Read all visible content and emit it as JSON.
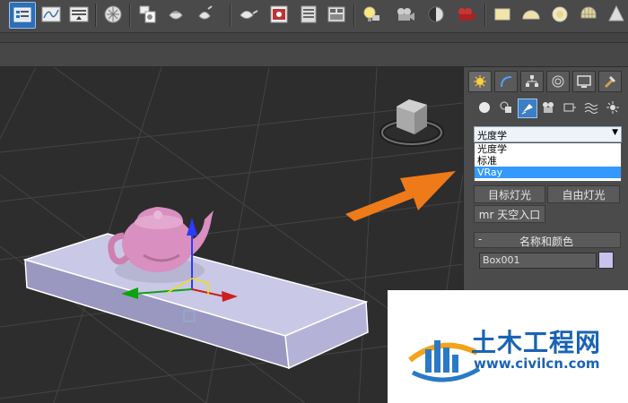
{
  "toolbar": {
    "icons": [
      "select-by-name-icon",
      "curve-editor-icon",
      "dope-sheet-icon",
      "schematic-view-icon",
      "material-editor-icon",
      "render-setup-icon",
      "render-frame-icon",
      "teapot-icon",
      "rendered-frame-window-icon",
      "layer-manager-icon",
      "ribbon-icon",
      "light-bulb-icon",
      "camera-icon",
      "environment-icon",
      "render-icon",
      "box-primitive-icon",
      "sphere-primitive-icon",
      "torus-primitive-icon",
      "geosphere-icon",
      "cone-icon"
    ]
  },
  "command_panel": {
    "tabs": [
      "create-tab",
      "modify-tab",
      "hierarchy-tab",
      "motion-tab",
      "display-tab",
      "utilities-tab"
    ],
    "object_types": [
      "geometry-icon",
      "shapes-icon",
      "lights-icon",
      "cameras-icon",
      "helpers-icon",
      "space-warps-icon",
      "systems-icon"
    ],
    "dropdown": {
      "selected": "光度学",
      "options": [
        "光度学",
        "标准",
        "VRay"
      ],
      "highlighted_index": 2
    },
    "buttons": {
      "target_light": "目标灯光",
      "free_light": "自由灯光",
      "mr_sky_portal": "mr 天空入口"
    },
    "rollout": {
      "toggle": "-",
      "title": "名称和颜色"
    },
    "name_field": "Box001",
    "color_swatch": "#c8c2ec"
  },
  "watermark": {
    "title": "土木工程网",
    "url": "www.civilcn.com"
  },
  "colors": {
    "arrow": "#ef7a1a",
    "selection_blue": "#3399ff",
    "box_top": "#c9c8e6",
    "teapot": "#d98fbf"
  }
}
